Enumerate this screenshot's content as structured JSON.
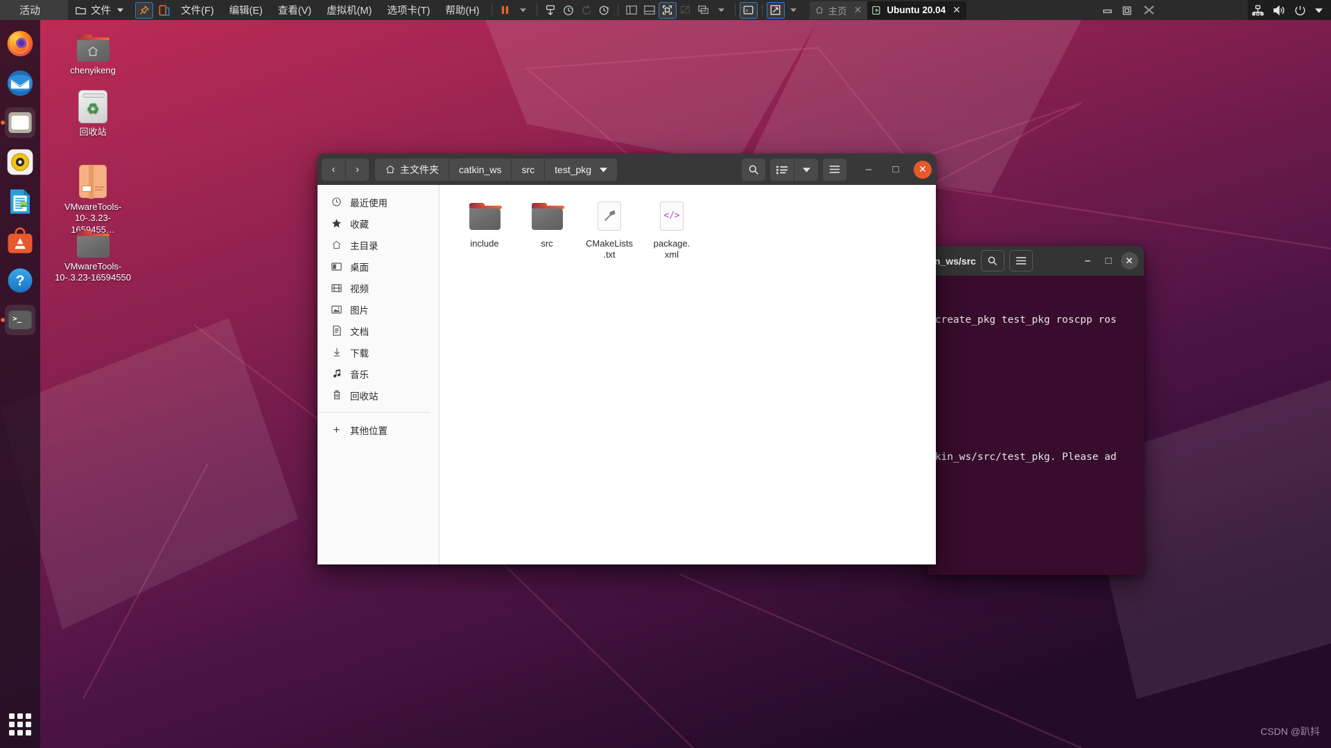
{
  "vmware": {
    "activities_label": "活动",
    "app_menu_label": "文件",
    "menus": [
      "文件(F)",
      "编辑(E)",
      "查看(V)",
      "虚拟机(M)",
      "选项卡(T)",
      "帮助(H)"
    ],
    "toolbar_icons": [
      "pin-icon",
      "restore-icon",
      "pause-icon",
      "chevron-down-icon",
      "snapshot-icon",
      "snapshot-take-icon",
      "snapshot-revert-icon",
      "snapshot-manager-icon",
      "panel-left-icon",
      "panel-bottom-icon",
      "fullscreen-icon",
      "unity-icon",
      "multimonitor-icon",
      "chevron-down-icon-2",
      "console-icon",
      "stretch-icon",
      "chevron-down-icon-3"
    ],
    "tabs": [
      {
        "label": "主页",
        "icon": "home-icon",
        "active": false,
        "close": "✕"
      },
      {
        "label": "Ubuntu 20.04",
        "icon": "vm-play-icon",
        "active": true,
        "close": "✕"
      }
    ],
    "window_controls": [
      "minimize-icon",
      "restore-icon",
      "close-icon"
    ]
  },
  "ubuntu_panel": {
    "indicators": [
      "network-icon",
      "volume-icon",
      "power-icon",
      "chevron-down-icon"
    ]
  },
  "dock": {
    "items": [
      {
        "name": "firefox",
        "running": false
      },
      {
        "name": "thunderbird",
        "running": false
      },
      {
        "name": "files",
        "running": true
      },
      {
        "name": "rhythmbox",
        "running": false
      },
      {
        "name": "libreoffice-writer",
        "running": false
      },
      {
        "name": "ubuntu-software",
        "running": false
      },
      {
        "name": "help",
        "running": false
      },
      {
        "name": "terminal",
        "running": true
      }
    ],
    "show_apps_label": "show-applications"
  },
  "desktop": {
    "icons": [
      {
        "name": "chenyikeng",
        "label": "chenyikeng",
        "type": "home-folder"
      },
      {
        "name": "trash",
        "label": "回收站",
        "type": "trash"
      },
      {
        "name": "vmware-tools-archive",
        "label": "VMwareTools-10-.3.23-1659455…",
        "type": "archive"
      },
      {
        "name": "vmware-tools-folder",
        "label": "VMwareTools-10-.3.23-16594550",
        "type": "folder"
      }
    ]
  },
  "files_window": {
    "breadcrumbs": [
      {
        "label": "主文件夹",
        "icon": "home-icon"
      },
      {
        "label": "catkin_ws",
        "icon": ""
      },
      {
        "label": "src",
        "icon": ""
      },
      {
        "label": "test_pkg",
        "icon": "chevron-down-icon"
      }
    ],
    "nav": {
      "back": "‹",
      "forward": "›"
    },
    "header_buttons": [
      "search-icon",
      "list-view-icon",
      "chevron-down-icon",
      "hamburger-menu-icon"
    ],
    "window_controls": {
      "minimize": "–",
      "maximize": "□",
      "close": "✕"
    },
    "sidebar": [
      {
        "label": "最近使用",
        "icon": "clock-icon"
      },
      {
        "label": "收藏",
        "icon": "star-icon"
      },
      {
        "label": "主目录",
        "icon": "home-icon"
      },
      {
        "label": "桌面",
        "icon": "desktop-icon"
      },
      {
        "label": "视频",
        "icon": "film-icon"
      },
      {
        "label": "图片",
        "icon": "image-icon"
      },
      {
        "label": "文档",
        "icon": "document-icon"
      },
      {
        "label": "下载",
        "icon": "download-icon"
      },
      {
        "label": "音乐",
        "icon": "music-icon"
      },
      {
        "label": "回收站",
        "icon": "trash-icon"
      }
    ],
    "sidebar_other": {
      "label": "其他位置",
      "icon": "plus-icon"
    },
    "files": [
      {
        "name": "include",
        "label": "include",
        "type": "folder"
      },
      {
        "name": "src",
        "label": "src",
        "type": "folder"
      },
      {
        "name": "cmakelists",
        "label": "CMakeLists\n.txt",
        "type": "build-file"
      },
      {
        "name": "package-xml",
        "label": "package.\nxml",
        "type": "xml-file"
      }
    ]
  },
  "terminal_window": {
    "title": "in_ws/src",
    "header_buttons": [
      "search-icon",
      "hamburger-menu-icon"
    ],
    "window_controls": {
      "minimize": "–",
      "maximize": "□",
      "close": "✕"
    },
    "lines": [
      "_create_pkg test_pkg roscpp ros",
      "",
      "",
      "",
      "tkin_ws/src/test_pkg. Please ad"
    ]
  },
  "watermark": {
    "text": "CSDN @趴抖"
  },
  "colors": {
    "ubuntu_orange": "#e8582b",
    "vmware_chrome": "#2b2b2b",
    "terminal_bg": "#380c2c",
    "header_bg": "#383838",
    "accent_blue": "#2a7fd4"
  }
}
